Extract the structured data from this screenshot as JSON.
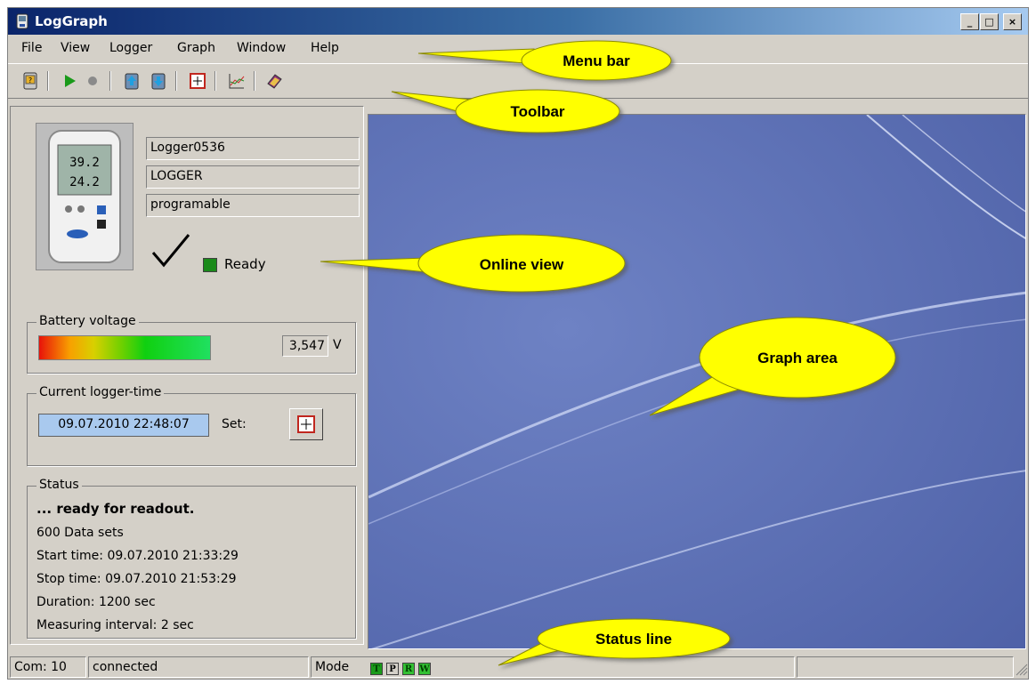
{
  "window": {
    "title": "LogGraph",
    "controls": [
      "_",
      "□",
      "×"
    ]
  },
  "menu": {
    "items": [
      "File",
      "View",
      "Logger",
      "Graph",
      "Window",
      "Help"
    ]
  },
  "toolbar": {
    "icons": [
      "logger-info-icon",
      "start-icon",
      "stop-icon",
      "read-logger-icon",
      "write-logger-icon",
      "set-time-icon",
      "graph-icon",
      "help-book-icon"
    ]
  },
  "device": {
    "name": "Logger0536",
    "type": "LOGGER",
    "mode": "programable",
    "ready_label": "Ready",
    "display": {
      "value1": "39.2",
      "value2": "24.2"
    }
  },
  "battery": {
    "legend": "Battery voltage",
    "value": "3,547",
    "unit": "V"
  },
  "logger_time": {
    "legend": "Current logger-time",
    "value": "09.07.2010 22:48:07",
    "set_label": "Set:"
  },
  "status": {
    "legend": "Status",
    "headline": "... ready for readout.",
    "lines": [
      "600 Data sets",
      "Start time: 09.07.2010 21:33:29",
      "Stop time: 09.07.2010 21:53:29",
      "Duration: 1200 sec",
      "Measuring interval: 2 sec"
    ]
  },
  "statusbar": {
    "com": "Com: 10",
    "connection": "connected",
    "mode_label": "Mode",
    "mode_indicators": [
      "T",
      "P",
      "R",
      "W"
    ]
  },
  "callouts": {
    "menu_bar": "Menu bar",
    "toolbar": "Toolbar",
    "online_view": "Online view",
    "graph_area": "Graph area",
    "status_line": "Status line"
  },
  "colors": {
    "callout_fill": "#ffff00",
    "ready_led": "#1a8a1a",
    "time_field_bg": "#a9c9ee",
    "graph_bg": "#5b6fb2"
  }
}
